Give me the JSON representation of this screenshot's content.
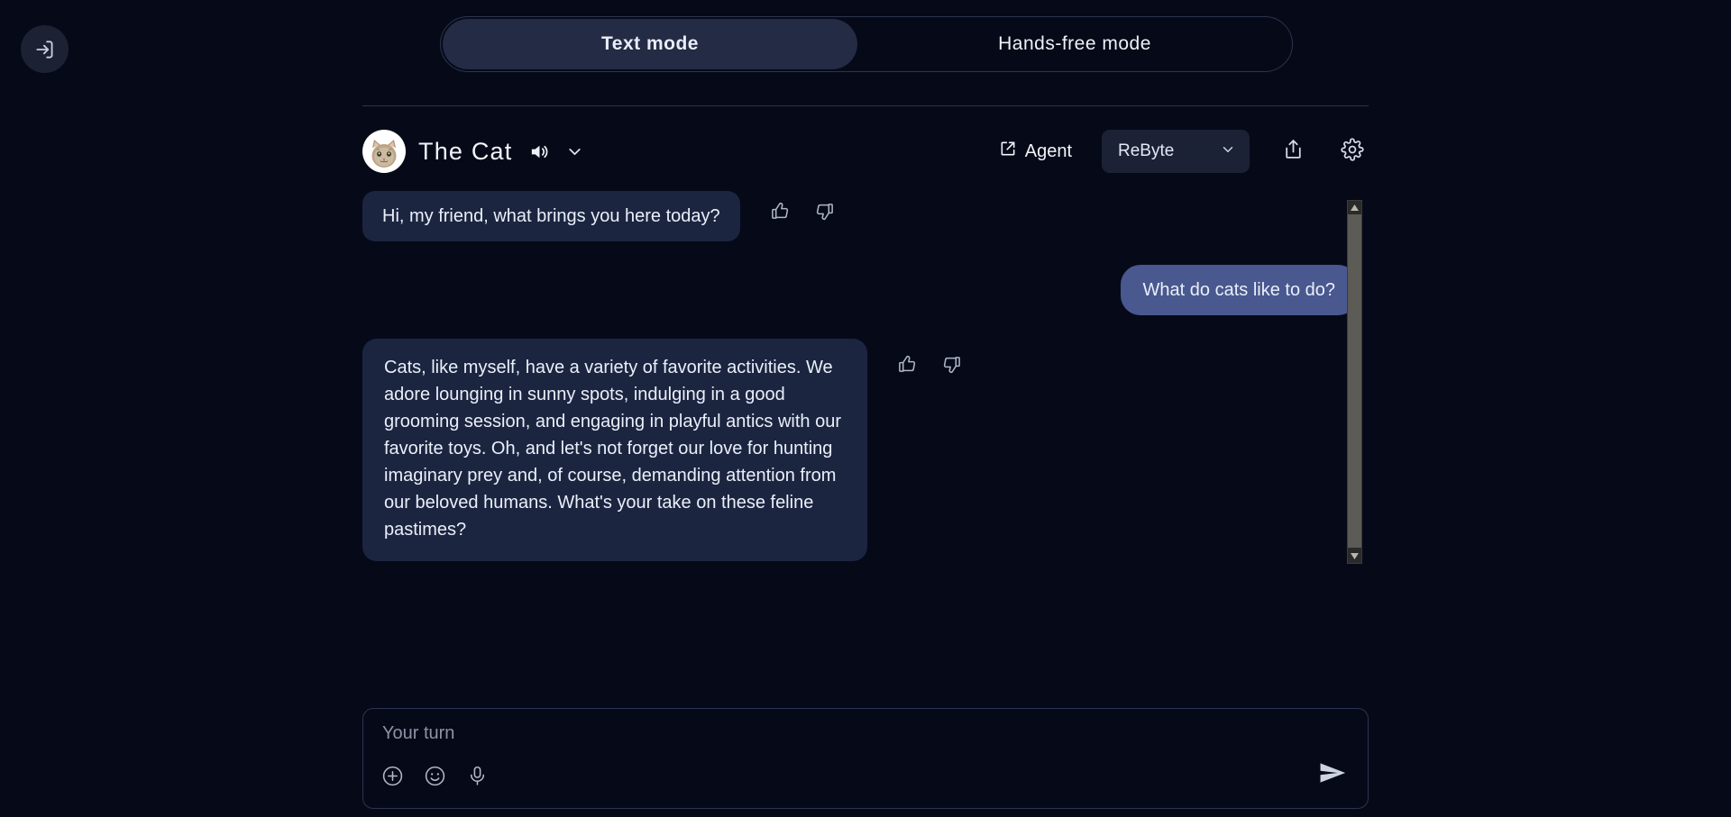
{
  "window": {
    "background_color": "#060a18"
  },
  "login_button": {
    "icon": "login-enter-icon"
  },
  "mode_toggle": {
    "options": [
      {
        "label": "Text  mode",
        "selected": true
      },
      {
        "label": "Hands-free  mode",
        "selected": false
      }
    ],
    "active_pill_color": "#232b45",
    "border_color": "#2b3350"
  },
  "header": {
    "avatar": "cat-avatar",
    "title": "The Cat",
    "speaker_icon": "speaker-volume-icon",
    "chevron_icon": "chevron-down-icon",
    "agent_label": "Agent",
    "agent_icon": "external-link-icon",
    "model": {
      "value": "ReByte",
      "chevron_icon": "chevron-down-icon"
    },
    "share_icon": "share-upload-icon",
    "settings_icon": "gear-icon"
  },
  "messages": [
    {
      "role": "assistant",
      "text": "Hi, my friend, what brings you here today?",
      "thumbs_up": "thumbs-up-icon",
      "thumbs_down": "thumbs-down-icon"
    },
    {
      "role": "user",
      "text": "What do cats like to do?"
    },
    {
      "role": "assistant",
      "text": "Cats, like myself, have a variety of favorite activities. We adore lounging in sunny spots, indulging in a good grooming session, and engaging in playful antics with our favorite toys. Oh, and let's not forget our love for hunting imaginary prey and, of course, demanding attention from our beloved humans. What's your take on these feline pastimes?",
      "thumbs_up": "thumbs-up-icon",
      "thumbs_down": "thumbs-down-icon"
    }
  ],
  "colors": {
    "bot_bubble": "#1c2540",
    "user_bubble": "#49588f",
    "panel": "#1b2236"
  },
  "composer": {
    "placeholder": "Your turn",
    "value": "",
    "attach_icon": "plus-circle-icon",
    "emoji_icon": "emoji-smiley-icon",
    "mic_icon": "microphone-icon",
    "send_icon": "send-paper-plane-icon"
  },
  "scrollbar": {
    "up_arrow": "scroll-up-arrow-icon",
    "down_arrow": "scroll-down-arrow-icon"
  }
}
